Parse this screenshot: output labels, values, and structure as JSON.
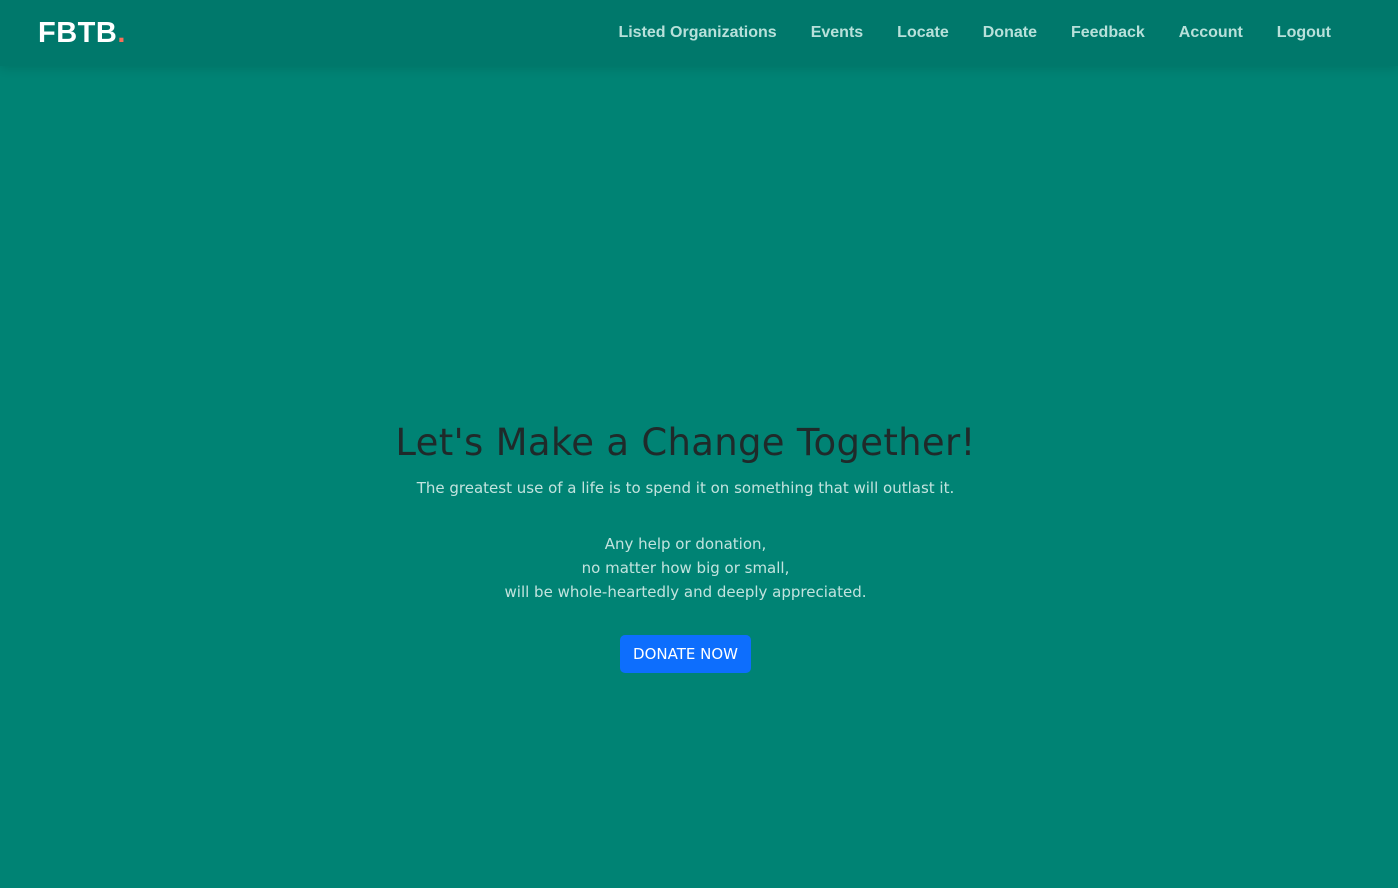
{
  "header": {
    "logo_text": "FBTB",
    "logo_dot": ".",
    "nav": [
      {
        "label": "Listed Organizations"
      },
      {
        "label": "Events"
      },
      {
        "label": "Locate"
      },
      {
        "label": "Donate"
      },
      {
        "label": "Feedback"
      },
      {
        "label": "Account"
      },
      {
        "label": "Logout"
      }
    ]
  },
  "hero": {
    "title": "Let's Make a Change Together!",
    "subtitle": "The greatest use of a life is to spend it on something that will outlast it.",
    "appeal_lines": [
      "Any help or donation,",
      "no matter how big or small,",
      "will be whole-heartedly and deeply appreciated."
    ],
    "cta_label": "DONATE NOW"
  },
  "colors": {
    "background": "#008374",
    "navbar": "#00786b",
    "logo_dot": "#f96f59",
    "button": "#0d6efd"
  }
}
